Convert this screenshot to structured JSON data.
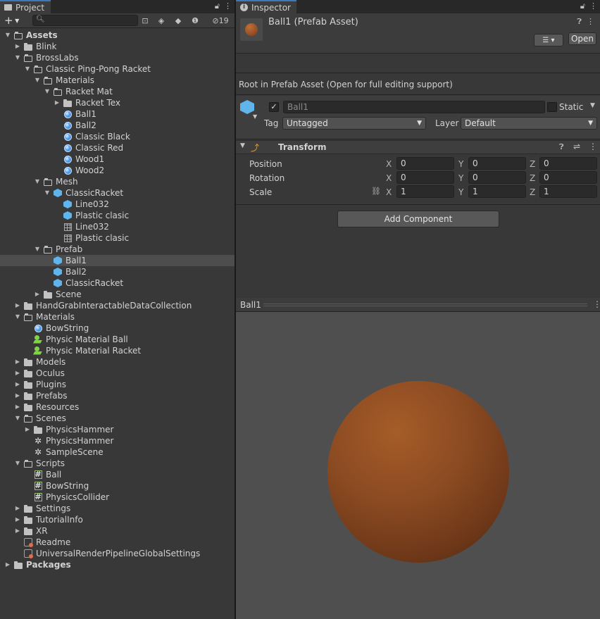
{
  "project": {
    "tab_title": "Project",
    "hidden_count": "19",
    "search_placeholder": "",
    "tree": [
      {
        "label": "Assets",
        "depth": 0,
        "arrow": "open",
        "icon": "folder-open",
        "bold": true
      },
      {
        "label": "Blink",
        "depth": 1,
        "arrow": "closed",
        "icon": "folder"
      },
      {
        "label": "BrossLabs",
        "depth": 1,
        "arrow": "open",
        "icon": "folder-open"
      },
      {
        "label": "Classic Ping-Pong Racket",
        "depth": 2,
        "arrow": "open",
        "icon": "folder-open"
      },
      {
        "label": "Materials",
        "depth": 3,
        "arrow": "open",
        "icon": "folder-open"
      },
      {
        "label": "Racket Mat",
        "depth": 4,
        "arrow": "open",
        "icon": "folder-open"
      },
      {
        "label": "Racket Tex",
        "depth": 5,
        "arrow": "closed",
        "icon": "folder"
      },
      {
        "label": "Ball1",
        "depth": 5,
        "arrow": "",
        "icon": "material"
      },
      {
        "label": "Ball2",
        "depth": 5,
        "arrow": "",
        "icon": "material"
      },
      {
        "label": "Classic Black",
        "depth": 5,
        "arrow": "",
        "icon": "material"
      },
      {
        "label": "Classic Red",
        "depth": 5,
        "arrow": "",
        "icon": "material"
      },
      {
        "label": "Wood1",
        "depth": 5,
        "arrow": "",
        "icon": "material"
      },
      {
        "label": "Wood2",
        "depth": 5,
        "arrow": "",
        "icon": "material"
      },
      {
        "label": "Mesh",
        "depth": 3,
        "arrow": "open",
        "icon": "folder-open"
      },
      {
        "label": "ClassicRacket",
        "depth": 4,
        "arrow": "open",
        "icon": "prefab"
      },
      {
        "label": "Line032",
        "depth": 5,
        "arrow": "",
        "icon": "prefab"
      },
      {
        "label": "Plastic clasic",
        "depth": 5,
        "arrow": "",
        "icon": "prefab"
      },
      {
        "label": "Line032",
        "depth": 5,
        "arrow": "",
        "icon": "mesh"
      },
      {
        "label": "Plastic clasic",
        "depth": 5,
        "arrow": "",
        "icon": "mesh"
      },
      {
        "label": "Prefab",
        "depth": 3,
        "arrow": "open",
        "icon": "folder-open"
      },
      {
        "label": "Ball1",
        "depth": 4,
        "arrow": "",
        "icon": "prefab",
        "selected": true
      },
      {
        "label": "Ball2",
        "depth": 4,
        "arrow": "",
        "icon": "prefab"
      },
      {
        "label": "ClassicRacket",
        "depth": 4,
        "arrow": "",
        "icon": "prefab"
      },
      {
        "label": "Scene",
        "depth": 3,
        "arrow": "closed",
        "icon": "folder"
      },
      {
        "label": "HandGrabInteractableDataCollection",
        "depth": 1,
        "arrow": "closed",
        "icon": "folder"
      },
      {
        "label": "Materials",
        "depth": 1,
        "arrow": "open",
        "icon": "folder-open"
      },
      {
        "label": "BowString",
        "depth": 2,
        "arrow": "",
        "icon": "material"
      },
      {
        "label": "Physic Material Ball",
        "depth": 2,
        "arrow": "",
        "icon": "physic-material"
      },
      {
        "label": "Physic Material Racket",
        "depth": 2,
        "arrow": "",
        "icon": "physic-material"
      },
      {
        "label": "Models",
        "depth": 1,
        "arrow": "closed",
        "icon": "folder"
      },
      {
        "label": "Oculus",
        "depth": 1,
        "arrow": "closed",
        "icon": "folder"
      },
      {
        "label": "Plugins",
        "depth": 1,
        "arrow": "closed",
        "icon": "folder"
      },
      {
        "label": "Prefabs",
        "depth": 1,
        "arrow": "closed",
        "icon": "folder"
      },
      {
        "label": "Resources",
        "depth": 1,
        "arrow": "closed",
        "icon": "folder"
      },
      {
        "label": "Scenes",
        "depth": 1,
        "arrow": "open",
        "icon": "folder-open"
      },
      {
        "label": "PhysicsHammer",
        "depth": 2,
        "arrow": "closed",
        "icon": "folder"
      },
      {
        "label": "PhysicsHammer",
        "depth": 2,
        "arrow": "",
        "icon": "unity-scene"
      },
      {
        "label": "SampleScene",
        "depth": 2,
        "arrow": "",
        "icon": "unity-scene"
      },
      {
        "label": "Scripts",
        "depth": 1,
        "arrow": "open",
        "icon": "folder-open"
      },
      {
        "label": "Ball",
        "depth": 2,
        "arrow": "",
        "icon": "script"
      },
      {
        "label": "BowString",
        "depth": 2,
        "arrow": "",
        "icon": "script"
      },
      {
        "label": "PhysicsCollider",
        "depth": 2,
        "arrow": "",
        "icon": "script"
      },
      {
        "label": "Settings",
        "depth": 1,
        "arrow": "closed",
        "icon": "folder"
      },
      {
        "label": "TutorialInfo",
        "depth": 1,
        "arrow": "closed",
        "icon": "folder"
      },
      {
        "label": "XR",
        "depth": 1,
        "arrow": "closed",
        "icon": "folder"
      },
      {
        "label": "Readme",
        "depth": 1,
        "arrow": "",
        "icon": "readme"
      },
      {
        "label": "UniversalRenderPipelineGlobalSettings",
        "depth": 1,
        "arrow": "",
        "icon": "readme"
      },
      {
        "label": "Packages",
        "depth": 0,
        "arrow": "closed",
        "icon": "folder",
        "bold": true
      }
    ]
  },
  "inspector": {
    "tab_title": "Inspector",
    "asset_title": "Ball1 (Prefab Asset)",
    "open_button": "Open",
    "root_message": "Root in Prefab Asset (Open for full editing support)",
    "object_name": "Ball1",
    "static_label": "Static",
    "tag_label": "Tag",
    "tag_value": "Untagged",
    "layer_label": "Layer",
    "layer_value": "Default",
    "transform": {
      "title": "Transform",
      "position_label": "Position",
      "rotation_label": "Rotation",
      "scale_label": "Scale",
      "axis_x": "X",
      "axis_y": "Y",
      "axis_z": "Z",
      "position": {
        "x": "0",
        "y": "0",
        "z": "0"
      },
      "rotation": {
        "x": "0",
        "y": "0",
        "z": "0"
      },
      "scale": {
        "x": "1",
        "y": "1",
        "z": "1"
      }
    },
    "add_component": "Add Component",
    "preview_title": "Ball1"
  },
  "colors": {
    "ball": "#8c4b22",
    "selection": "#4d4d4d",
    "tab_accent": "#3a79bb"
  }
}
